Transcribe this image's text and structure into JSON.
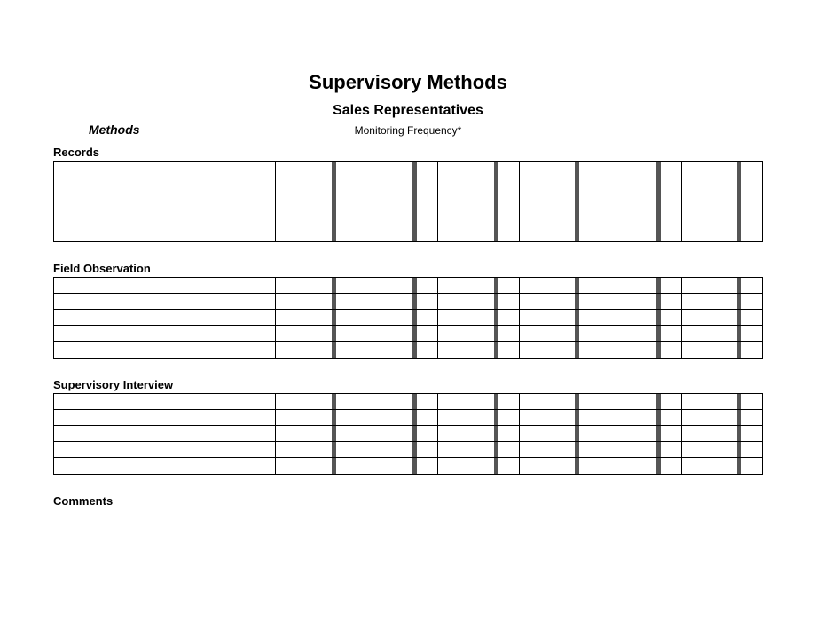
{
  "title": "Supervisory Methods",
  "subtitle": "Sales Representatives",
  "methods_label": "Methods",
  "freq_label": "Monitoring Frequency*",
  "sections": {
    "records": "Records",
    "field": "Field Observation",
    "interview": "Supervisory Interview",
    "comments": "Comments"
  },
  "rows_per_section": 5,
  "freq_columns": 6
}
